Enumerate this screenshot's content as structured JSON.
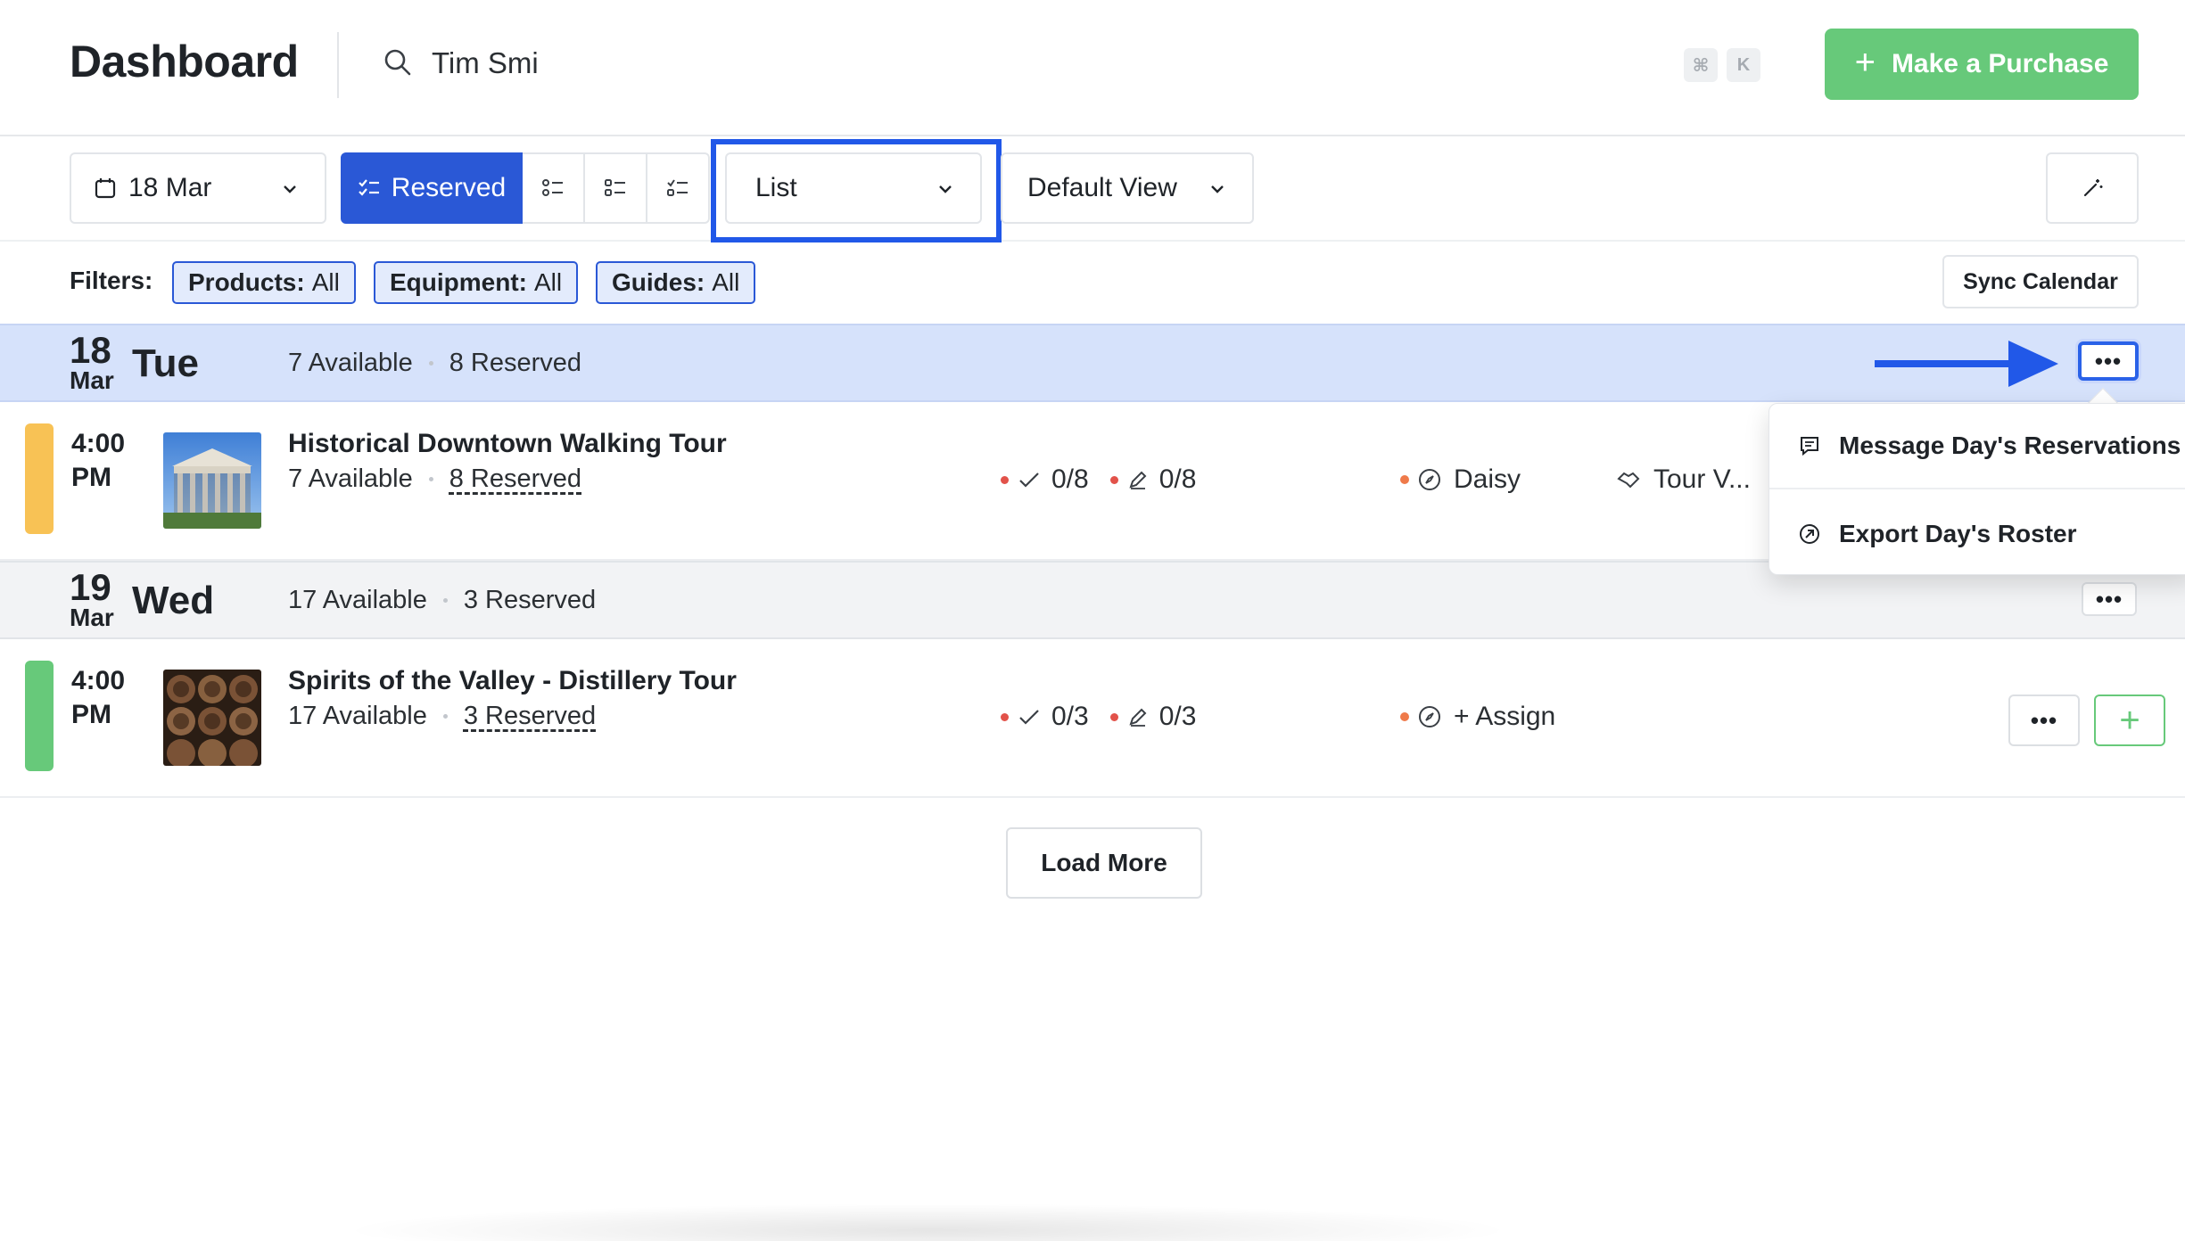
{
  "header": {
    "title": "Dashboard",
    "search_value": "Tim Smi",
    "search_placeholder": "",
    "kbd_cmd": "⌘",
    "kbd_k": "K",
    "purchase_label": "Make a Purchase"
  },
  "toolbar": {
    "date_label": "18 Mar",
    "reserved_label": "Reserved",
    "list_label": "List",
    "view_label": "Default View"
  },
  "filters": {
    "label": "Filters:",
    "chips": [
      {
        "key": "Products:",
        "value": "All"
      },
      {
        "key": "Equipment:",
        "value": "All"
      },
      {
        "key": "Guides:",
        "value": "All"
      }
    ],
    "sync_label": "Sync Calendar"
  },
  "days": [
    {
      "day": "18",
      "month": "Mar",
      "weekday": "Tue",
      "available": "7 Available",
      "reserved": "8 Reserved",
      "tours": [
        {
          "time_h": "4:00",
          "time_ampm": "PM",
          "status_color": "#f8c255",
          "title": "Historical Downtown Walking Tour",
          "available": "7 Available",
          "reserved": "8 Reserved",
          "checked": "0/8",
          "signed": "0/8",
          "guide": "Daisy",
          "vendor": "Tour V..."
        }
      ]
    },
    {
      "day": "19",
      "month": "Mar",
      "weekday": "Wed",
      "available": "17 Available",
      "reserved": "3 Reserved",
      "tours": [
        {
          "time_h": "4:00",
          "time_ampm": "PM",
          "status_color": "#67c97a",
          "title": "Spirits of the Valley - Distillery Tour",
          "available": "17 Available",
          "reserved": "3 Reserved",
          "checked": "0/3",
          "signed": "0/3",
          "guide": "+ Assign"
        }
      ]
    }
  ],
  "menu": {
    "message_label": "Message Day's Reservations",
    "export_label": "Export Day's Roster"
  },
  "more_label": "•••",
  "load_more_label": "Load More",
  "colors": {
    "accent": "#2a58d6",
    "success": "#67c97a",
    "warning": "#f8c255",
    "highlight": "#2158e8"
  }
}
